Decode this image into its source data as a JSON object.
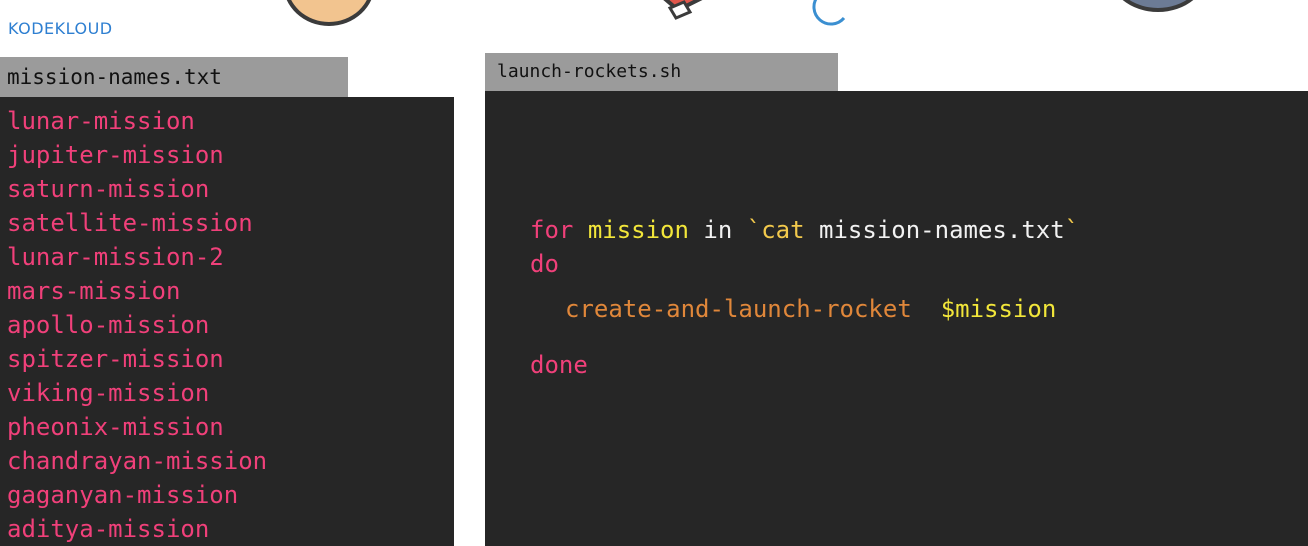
{
  "brand": {
    "name": "KODEKLOUD"
  },
  "left_file": {
    "filename": "mission-names.txt",
    "lines": [
      "lunar-mission",
      "jupiter-mission",
      "saturn-mission",
      "satellite-mission",
      "lunar-mission-2",
      "mars-mission",
      "apollo-mission",
      "spitzer-mission",
      "viking-mission",
      "pheonix-mission",
      "chandrayan-mission",
      "gaganyan-mission",
      "aditya-mission"
    ]
  },
  "right_file": {
    "filename": "launch-rockets.sh",
    "code": {
      "line1": {
        "keyword_for": "for",
        "variable": "mission",
        "keyword_in": "in",
        "backtick_open": "`cat",
        "filename": "mission-names.txt",
        "backtick_close": "`"
      },
      "line2": {
        "keyword_do": "do"
      },
      "line3": {
        "command": "create-and-launch-rocket",
        "argument": "$mission"
      },
      "line4": {
        "keyword_done": "done"
      }
    }
  },
  "colors": {
    "keyword": "#f0407a",
    "variable": "#f2e63a",
    "command": "#e0873a",
    "tab_background": "#9b9b9b",
    "pane_background": "#262626",
    "brand": "#2e7fd1"
  },
  "decorations": [
    "planet-icon",
    "rocket-icon",
    "moon-icon",
    "planet-icon"
  ]
}
